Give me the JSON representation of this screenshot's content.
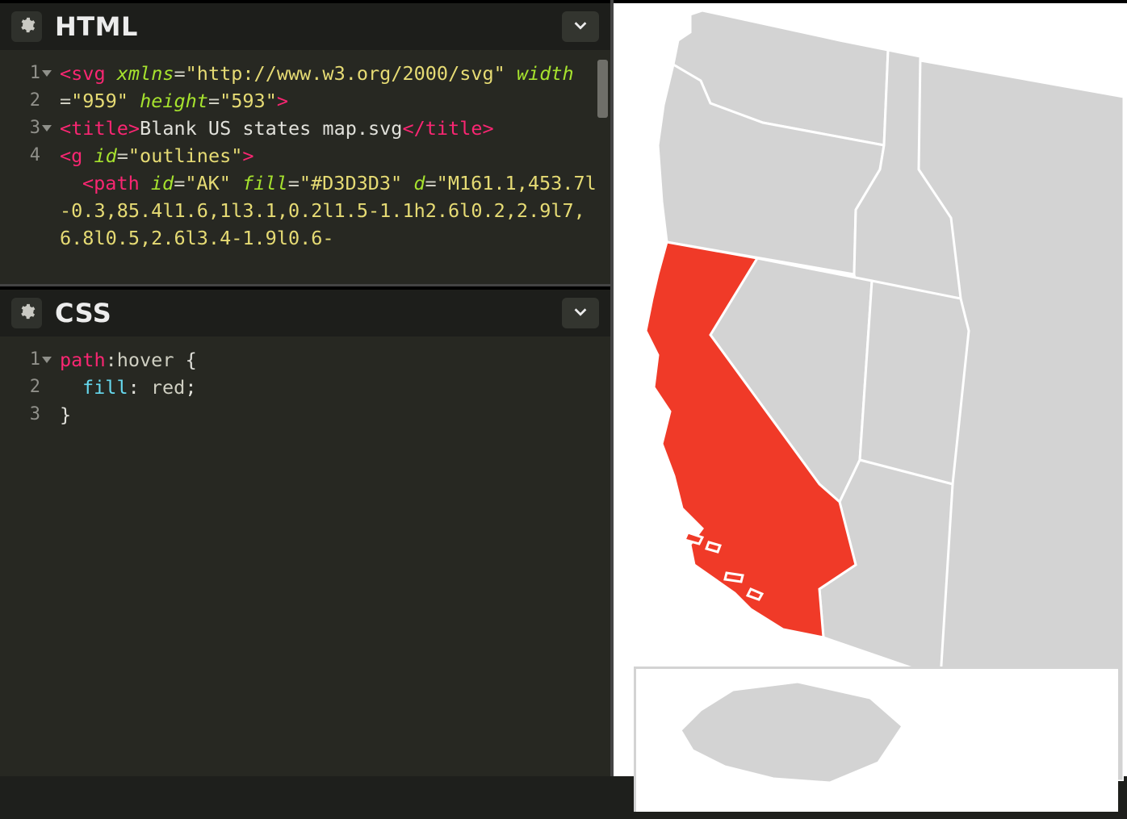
{
  "panels": {
    "html": {
      "title": "HTML"
    },
    "css": {
      "title": "CSS"
    }
  },
  "html_editor": {
    "lines": [
      "1",
      "2",
      "3",
      "4"
    ],
    "code": {
      "l1_tag_open": "<svg",
      "l1_attr1_name": "xmlns",
      "l1_attr1_val": "\"http://www.w3.org/2000/svg\"",
      "l1_attr2_name": "width",
      "l1_attr2_val": "\"959\"",
      "l1_attr3_name": "height",
      "l1_attr3_val": "\"593\"",
      "gt": ">",
      "l2_tag_open": "<title",
      "l2_text": "Blank US states map.svg",
      "l2_tag_close": "</title>",
      "l3_tag_open": "<g",
      "l3_attr1_name": "id",
      "l3_attr1_val": "\"outlines\"",
      "l4_tag_open": "<path",
      "l4_attr1_name": "id",
      "l4_attr1_val": "\"AK\"",
      "l4_attr2_name": "fill",
      "l4_attr2_val": "\"#D3D3D3\"",
      "l4_attr3_name": "d",
      "l4_d_val": "\"M161.1,453.7l-0.3,85.4l1.6,1l3.1,0.2l1.5-1.1h2.6l0.2,2.9l7,6.8l0.5,2.6l3.4-1.9l0.6-"
    }
  },
  "css_editor": {
    "lines": [
      "1",
      "2",
      "3"
    ],
    "code": {
      "selector": "path",
      "pseudo": ":hover",
      "brace_open": " {",
      "prop": "fill",
      "colon": ": ",
      "value": "red",
      "semi": ";",
      "brace_close": "}"
    }
  },
  "preview": {
    "map_title": "Blank US states map.svg",
    "hover_fill": "#f03a28",
    "default_fill": "#d3d3d3",
    "hovered_state": "CA"
  }
}
